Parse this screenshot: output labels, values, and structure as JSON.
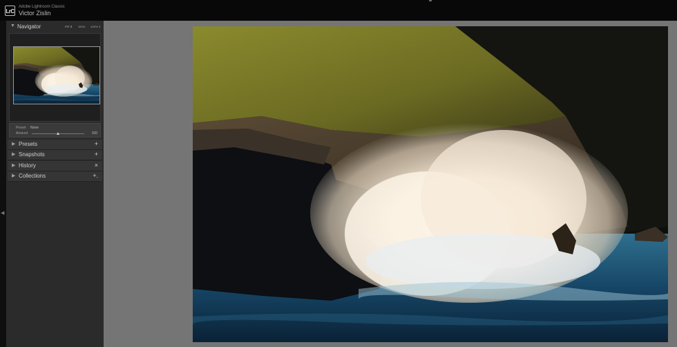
{
  "titlebar": {
    "logo": "LrC",
    "app_name": "Adobe Lightroom Classic",
    "user_name": "Victor Zislin"
  },
  "navigator": {
    "label": "Navigator",
    "zoom_options": [
      "FIT ⇕",
      "100%",
      "400% ⇕"
    ]
  },
  "preset": {
    "label": "Preset",
    "value": "None",
    "amount_label": "Amount",
    "amount_value": "100",
    "amount": 0.5
  },
  "sections": [
    {
      "label": "Presets",
      "icon": "+",
      "icon_name": "plus-icon"
    },
    {
      "label": "Snapshots",
      "icon": "+",
      "icon_name": "plus-icon"
    },
    {
      "label": "History",
      "icon": "×",
      "icon_name": "close-icon"
    },
    {
      "label": "Collections",
      "icon": "+.",
      "icon_name": "plus-icon"
    }
  ],
  "colors": {
    "panel_bg": "#2b2b2b",
    "canvas_bg": "#757575",
    "titlebar_bg": "#080808"
  },
  "photo": {
    "subject": "wave-crashing-on-coastal-cliff"
  }
}
